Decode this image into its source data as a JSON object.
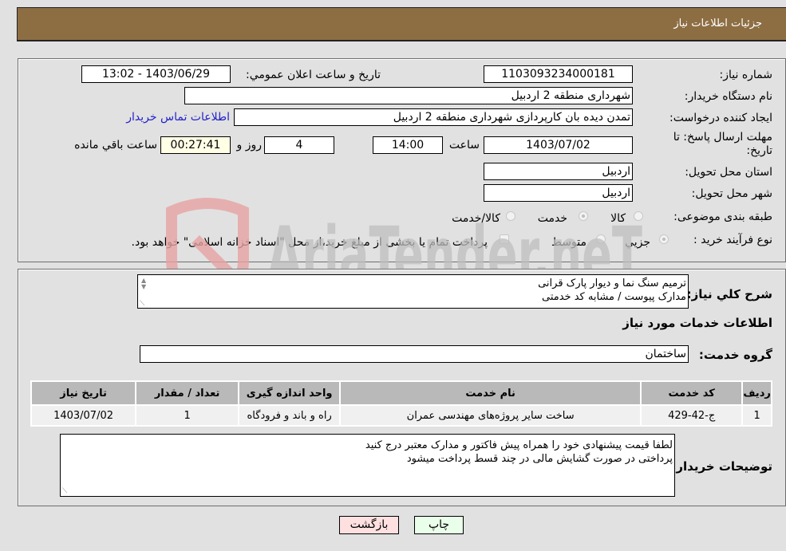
{
  "header": {
    "title": "جزئیات اطلاعات نیاز"
  },
  "details": {
    "need_number_label": "شماره نیاز:",
    "need_number": "1103093234000181",
    "announce_label": "تاریخ و ساعت اعلان عمومي:",
    "announce_value": "1403/06/29 - 13:02",
    "buyer_org_label": "نام دستگاه خریدار:",
    "buyer_org": "شهرداری منطقه 2 اردبیل",
    "creator_label": "ایجاد کننده درخواست:",
    "creator": "تمدن دیده بان کارپردازی شهرداری منطقه 2 اردبیل",
    "buyer_contact_link": "اطلاعات تماس خریدار",
    "deadline_label_line1": "مهلت ارسال پاسخ: تا",
    "deadline_label_line2": "تاریخ:",
    "deadline_date": "1403/07/02",
    "time_label": "ساعت",
    "deadline_time": "14:00",
    "days_value": "4",
    "days_label": "روز و",
    "remaining_time": "00:27:41",
    "remaining_label": "ساعت باقي مانده",
    "province_label": "استان محل تحویل:",
    "province": "اردبیل",
    "city_label": "شهر محل تحویل:",
    "city": "اردبیل",
    "category_label": "طبقه بندی موضوعی:",
    "category_options": [
      {
        "label": "کالا",
        "selected": false
      },
      {
        "label": "خدمت",
        "selected": true
      },
      {
        "label": "کالا/خدمت",
        "selected": false
      }
    ],
    "process_label": "نوع فرآیند خرید :",
    "process_options": [
      {
        "label": "جزيي",
        "selected": true
      },
      {
        "label": "متوسط",
        "selected": false
      }
    ],
    "treasury_checkbox_label": "پرداخت تمام یا بخشی از مبلغ خرید،از محل \"اسناد خزانه اسلامی\" خواهد بود.",
    "treasury_checked": false
  },
  "summary": {
    "description_label": "شرح کلي نياز:",
    "description_lines": [
      "ترمیم سنگ نما و دیوار پارک قرانی",
      "مدارک پیوست / مشابه کد خدمتی"
    ],
    "services_heading": "اطلاعات خدمات مورد نیاز",
    "service_group_label": "گروه خدمت:",
    "service_group": "ساختمان",
    "table": {
      "columns": [
        "ردیف",
        "کد خدمت",
        "نام خدمت",
        "واحد اندازه گیری",
        "تعداد / مقدار",
        "تاریخ نیاز"
      ],
      "rows": [
        [
          "1",
          "ج-42-429",
          "ساخت سایر پروژه‌های مهندسی عمران",
          "راه و باند و فرودگاه",
          "1",
          "1403/07/02"
        ]
      ]
    },
    "buyer_notes_label": "توضیحات خریدار:",
    "buyer_notes_lines": [
      "لطفا قیمت پیشنهادی خود را همراه پیش فاکتور و مدارک معتبر درج کنید",
      "پرداختی در صورت گشایش مالی در چند قسط پرداخت میشود"
    ]
  },
  "buttons": {
    "print": "چاپ",
    "back": "بازگشت"
  },
  "watermark": {
    "text": "AriaTender.neT",
    "colors": {
      "shield": "#e7a3a3",
      "text": "#bfbfbf"
    }
  }
}
